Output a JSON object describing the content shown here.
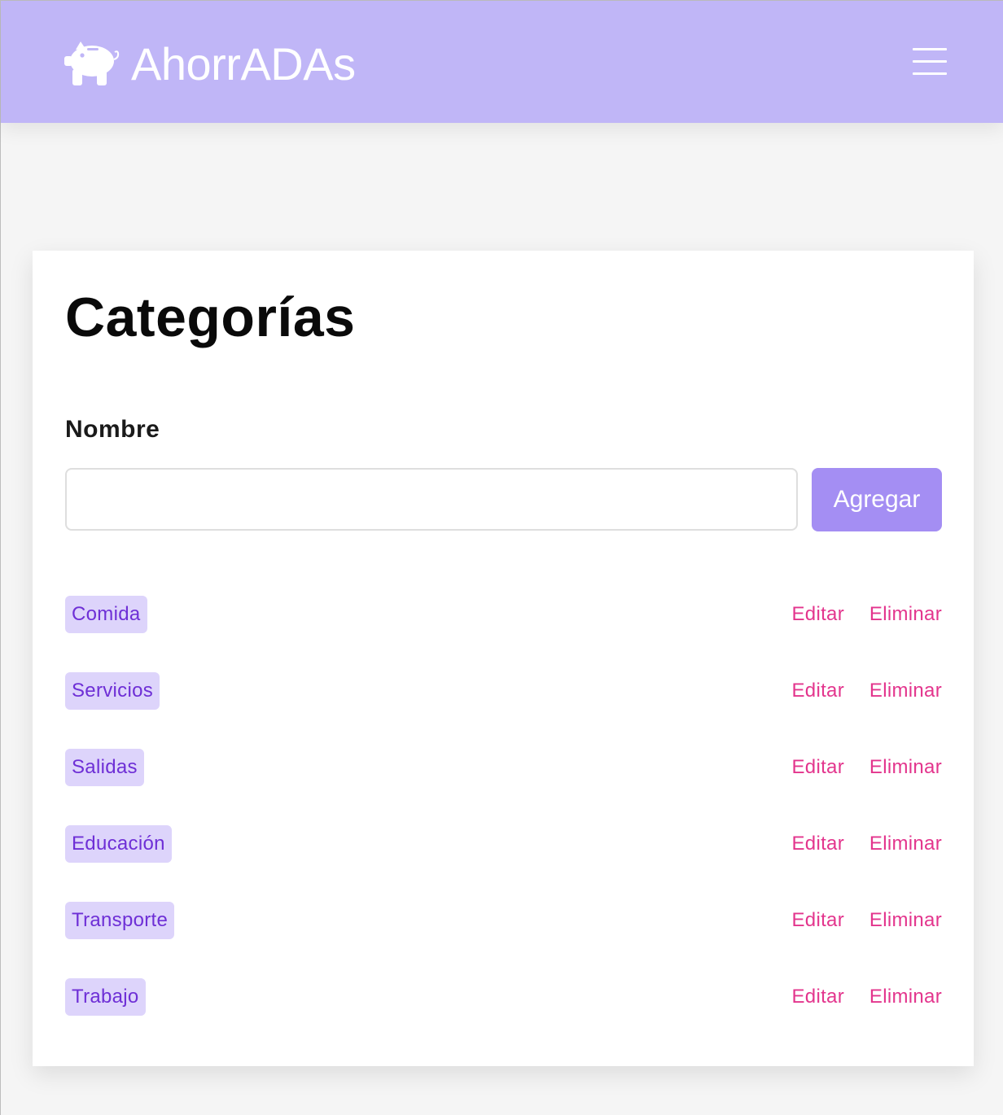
{
  "app": {
    "brand": "AhorrADAs",
    "logo_icon": "piggy-bank-icon",
    "menu_icon": "hamburger-menu-icon"
  },
  "categories_page": {
    "title": "Categorías",
    "name_label": "Nombre",
    "name_input": {
      "value": "",
      "placeholder": ""
    },
    "add_label": "Agregar",
    "items": [
      {
        "name": "Comida",
        "edit_label": "Editar",
        "delete_label": "Eliminar"
      },
      {
        "name": "Servicios",
        "edit_label": "Editar",
        "delete_label": "Eliminar"
      },
      {
        "name": "Salidas",
        "edit_label": "Editar",
        "delete_label": "Eliminar"
      },
      {
        "name": "Educación",
        "edit_label": "Editar",
        "delete_label": "Eliminar"
      },
      {
        "name": "Transporte",
        "edit_label": "Editar",
        "delete_label": "Eliminar"
      },
      {
        "name": "Trabajo",
        "edit_label": "Editar",
        "delete_label": "Eliminar"
      }
    ]
  },
  "colors": {
    "navbar": "#c0b6f7",
    "primary_button": "#a48ef3",
    "tag_background": "#ddd4fb",
    "tag_text": "#6e2fd6",
    "action_link": "#e3358d"
  }
}
